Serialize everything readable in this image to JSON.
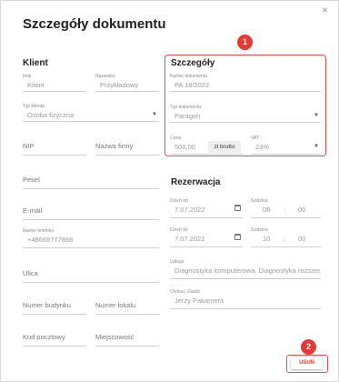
{
  "dialog": {
    "title": "Szczegóły dokumentu",
    "close_icon": "×"
  },
  "client": {
    "section_title": "Klient",
    "first_name": {
      "label": "Imię",
      "value": "Klient"
    },
    "last_name": {
      "label": "Nazwisko",
      "value": "Przykładowy"
    },
    "client_type": {
      "label": "Typ klienta",
      "value": "Osoba fizyczna"
    },
    "nip": {
      "placeholder": "NIP"
    },
    "company_name": {
      "placeholder": "Nazwa firmy"
    },
    "pesel": {
      "placeholder": "Pesel"
    },
    "email": {
      "placeholder": "E-mail"
    },
    "phone": {
      "label": "Numer telefonu",
      "value": "+48666777888"
    },
    "street": {
      "placeholder": "Ulica"
    },
    "building_number": {
      "placeholder": "Numer budynku"
    },
    "apartment_number": {
      "placeholder": "Numer lokalu"
    },
    "postal_code": {
      "placeholder": "Kod pocztowy"
    },
    "city": {
      "placeholder": "Miejscowość"
    }
  },
  "details": {
    "section_title": "Szczegóły",
    "doc_number": {
      "label": "Numer dokumentu",
      "value": "PA 18/2022"
    },
    "doc_type": {
      "label": "Typ dokumentu",
      "value": "Paragon"
    },
    "price": {
      "label": "Cena",
      "value": "500,00"
    },
    "price_mode": "zł brutto",
    "vat": {
      "label": "VAT",
      "value": "23%"
    }
  },
  "reservation": {
    "section_title": "Rezerwacja",
    "date_from": {
      "label": "Dzień od",
      "value": "7.07.2022"
    },
    "time_from": {
      "label": "Godzina",
      "hour": "08",
      "minute": "00"
    },
    "date_to": {
      "label": "Dzień do",
      "value": "7.07.2022"
    },
    "time_to": {
      "label": "Godzina",
      "hour": "10",
      "minute": "00"
    },
    "service": {
      "label": "Usługa",
      "value": "Diagnostyka komputerowa, Diagnostyka rozszerzona"
    },
    "person": {
      "label": "Osoba / Zasób",
      "value": "Jerzy Pakamera"
    }
  },
  "badges": {
    "first": "1",
    "second": "2"
  },
  "delete_button": "USUŃ",
  "colors": {
    "accent_red": "#e53935",
    "highlight_border": "#e74c4c"
  }
}
